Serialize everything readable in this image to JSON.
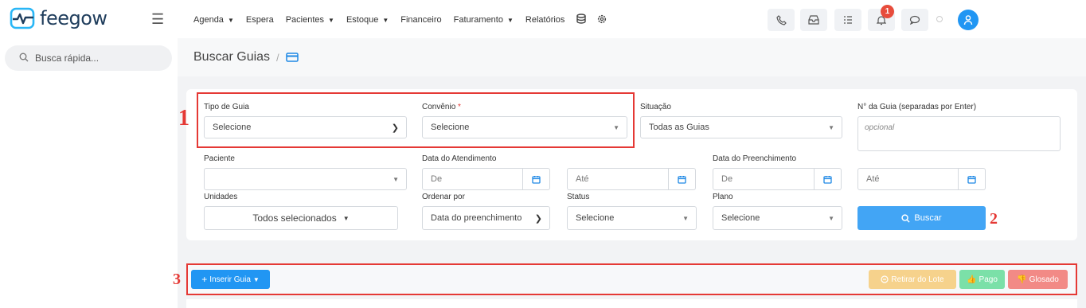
{
  "brand": {
    "name": "feegow",
    "accent": "#2196f3"
  },
  "nav": {
    "items": [
      {
        "label": "Agenda",
        "dropdown": true
      },
      {
        "label": "Espera",
        "dropdown": false
      },
      {
        "label": "Pacientes",
        "dropdown": true
      },
      {
        "label": "Estoque",
        "dropdown": true
      },
      {
        "label": "Financeiro",
        "dropdown": false
      },
      {
        "label": "Faturamento",
        "dropdown": true
      },
      {
        "label": "Relatórios",
        "dropdown": false
      }
    ],
    "extra_icons": [
      "database-icon",
      "settings-icon"
    ]
  },
  "toolbar_icons": [
    "phone-icon",
    "inbox-icon",
    "tasks-icon",
    "bell-icon",
    "chat-icon"
  ],
  "notifications_count": "1",
  "sidebar": {
    "search_placeholder": "Busca rápida..."
  },
  "page": {
    "title": "Buscar Guias",
    "separator": "/"
  },
  "form": {
    "tipo_guia": {
      "label": "Tipo de Guia",
      "value": "Selecione"
    },
    "convenio": {
      "label": "Convênio",
      "required_mark": "*",
      "value": "Selecione"
    },
    "situacao": {
      "label": "Situação",
      "value": "Todas as Guias"
    },
    "num_guia": {
      "label": "N° da Guia (separadas por Enter)",
      "placeholder": "opcional"
    },
    "paciente": {
      "label": "Paciente",
      "value": ""
    },
    "data_atendimento": {
      "label": "Data do Atendimento",
      "from_placeholder": "De",
      "to_placeholder": "Até"
    },
    "data_preenchimento": {
      "label": "Data do Preenchimento",
      "from_placeholder": "De",
      "to_placeholder": "Até"
    },
    "unidades": {
      "label": "Unidades",
      "value": "Todos selecionados"
    },
    "ordenar_por": {
      "label": "Ordenar por",
      "value": "Data do preenchimento"
    },
    "status": {
      "label": "Status",
      "value": "Selecione"
    },
    "plano": {
      "label": "Plano",
      "value": "Selecione"
    },
    "buscar_button": "Buscar"
  },
  "actions": {
    "inserir": "Inserir Guia",
    "retirar": "Retirar do Lote",
    "pago": "Pago",
    "glosado": "Glosado"
  },
  "annotations": {
    "one": "1",
    "two": "2",
    "three": "3"
  }
}
